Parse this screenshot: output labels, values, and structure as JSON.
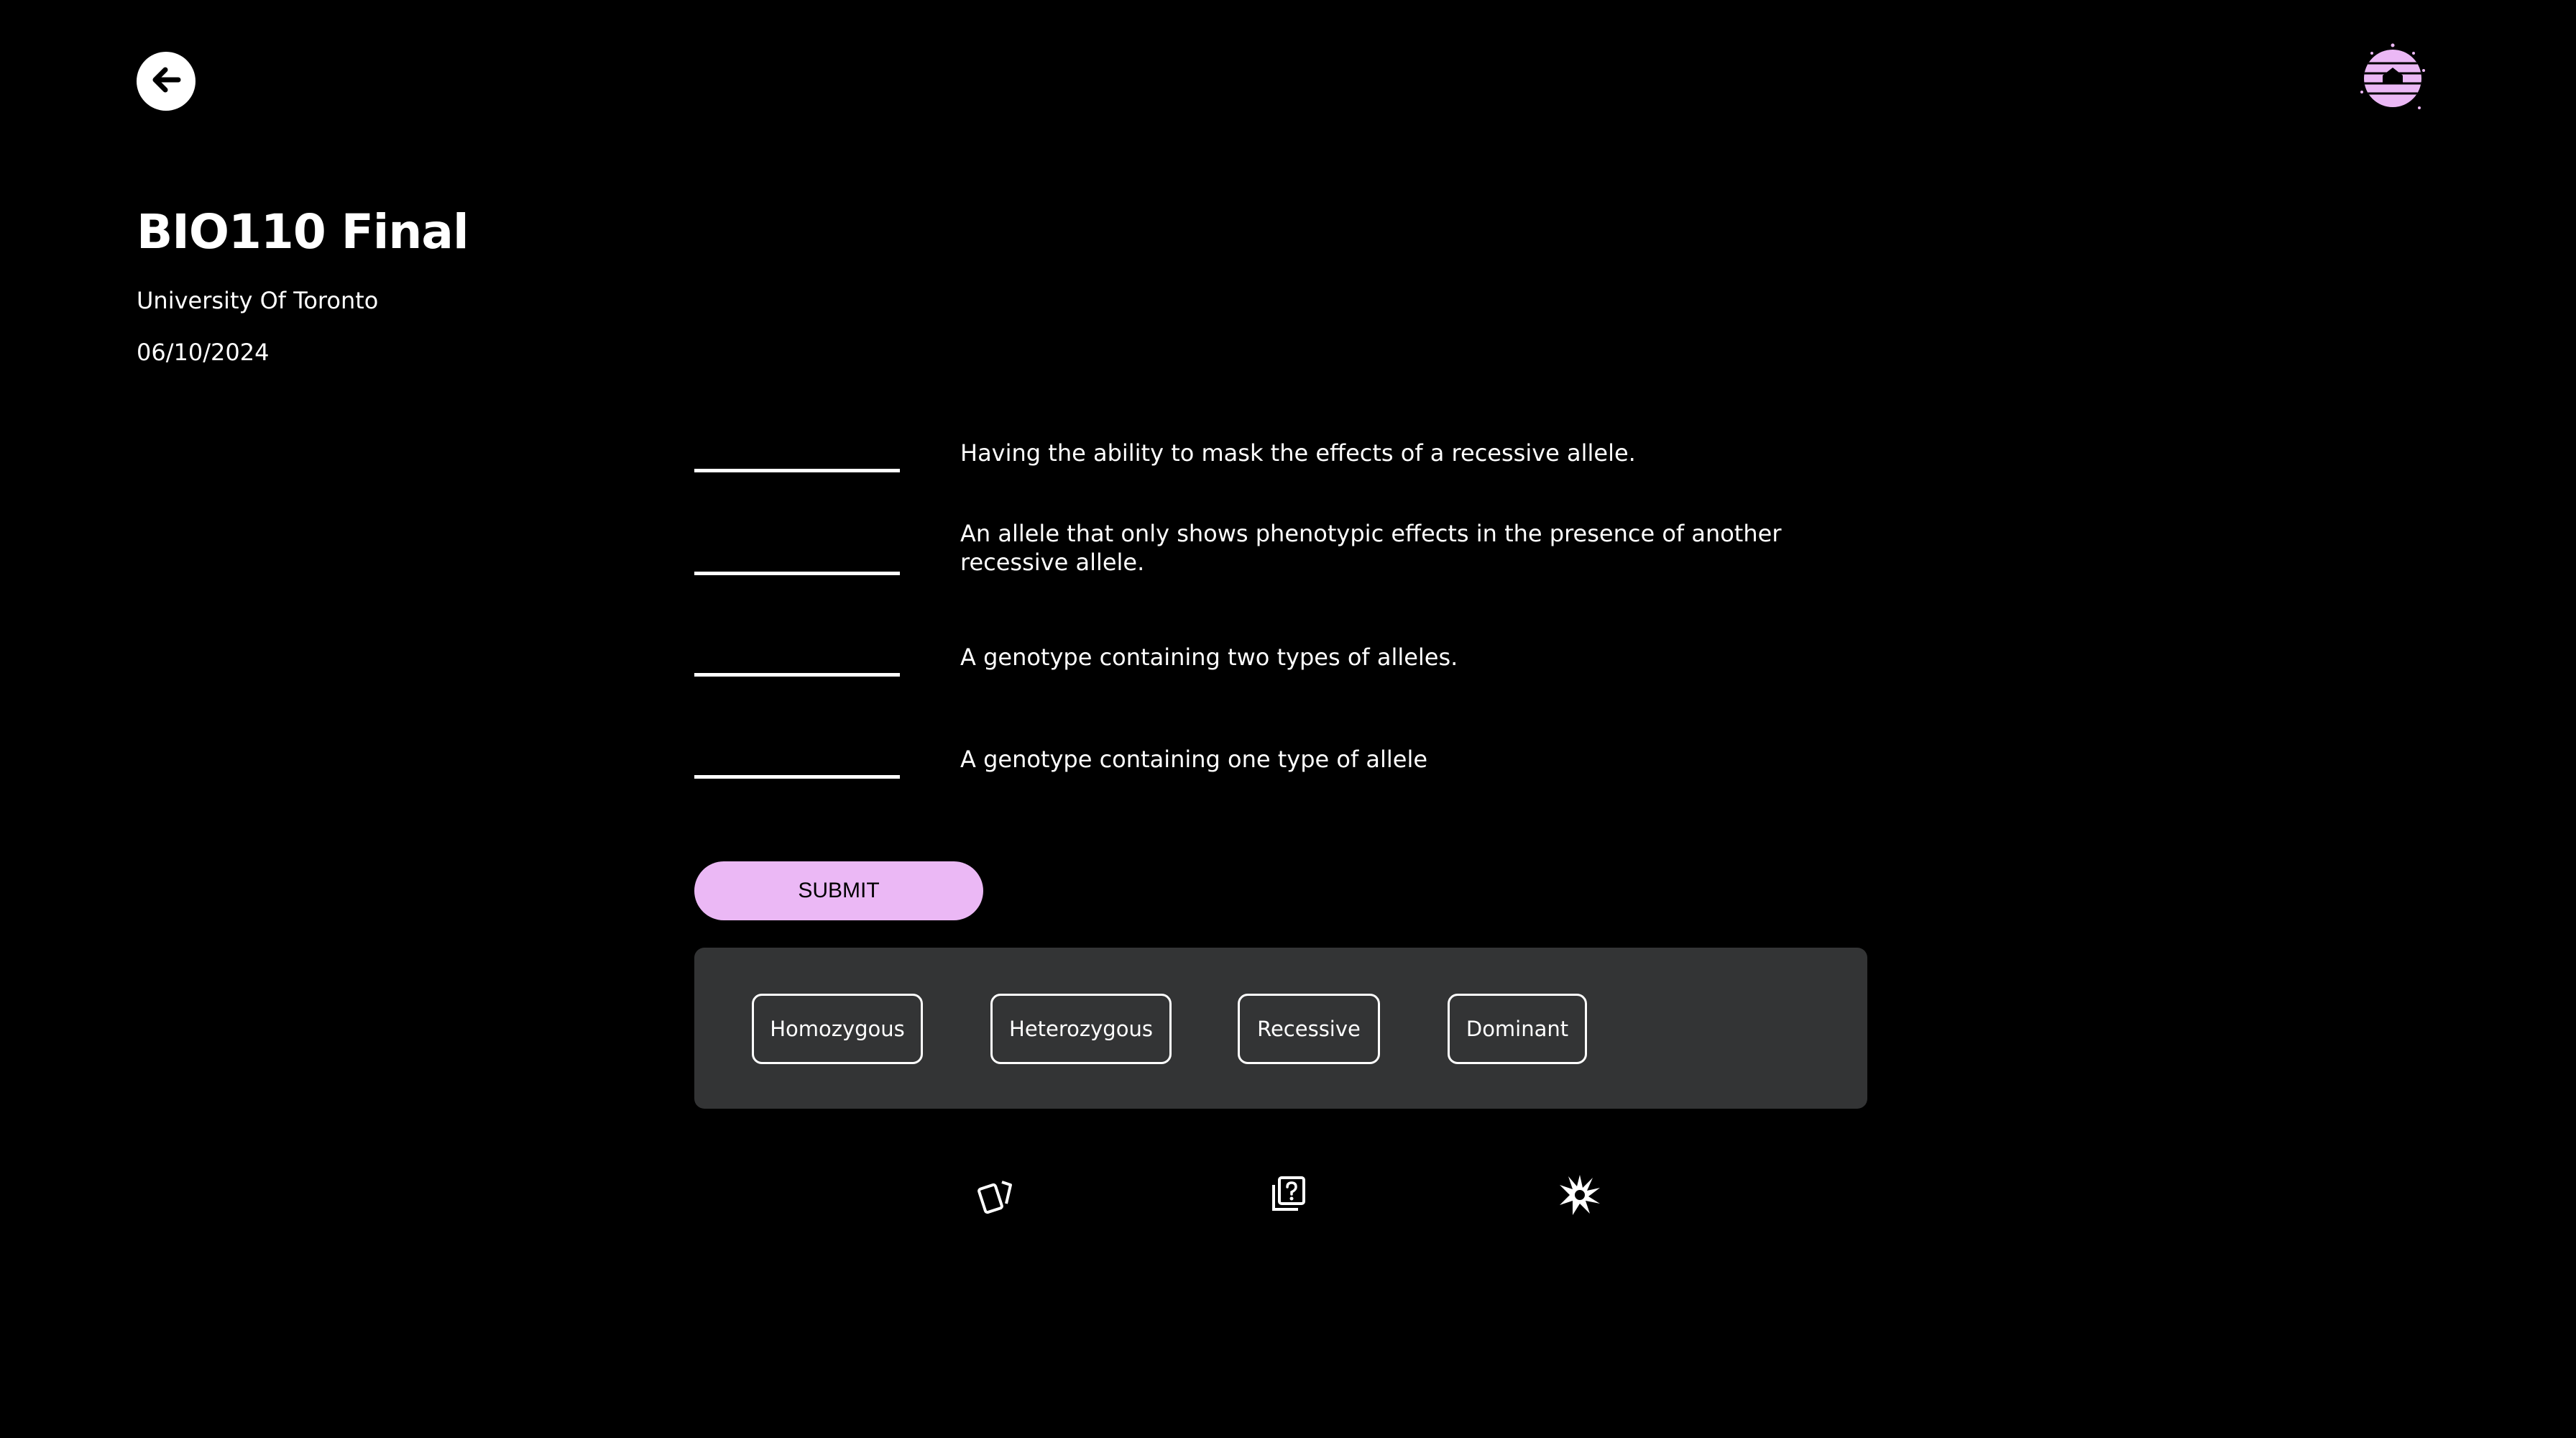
{
  "header": {
    "title": "BIO110 Final",
    "subtitle": "University Of Toronto",
    "date": "06/10/2024"
  },
  "questions": [
    {
      "text": "Having the ability to mask the effects of a recessive allele.",
      "answer": ""
    },
    {
      "text": "An allele that only shows phenotypic effects in the presence of another recessive allele.",
      "answer": ""
    },
    {
      "text": "A genotype containing two types of alleles.",
      "answer": ""
    },
    {
      "text": "A genotype containing one type of allele",
      "answer": ""
    }
  ],
  "submit": {
    "label": "SUBMIT"
  },
  "word_bank": [
    "Homozygous",
    "Heterozygous",
    "Recessive",
    "Dominant"
  ],
  "toolbar": {
    "icons": [
      "flashcards-icon",
      "quiz-icon",
      "burst-icon"
    ]
  },
  "colors": {
    "accent": "#ebb8f5",
    "background": "#000000",
    "panel": "#333435",
    "text": "#ffffff"
  }
}
